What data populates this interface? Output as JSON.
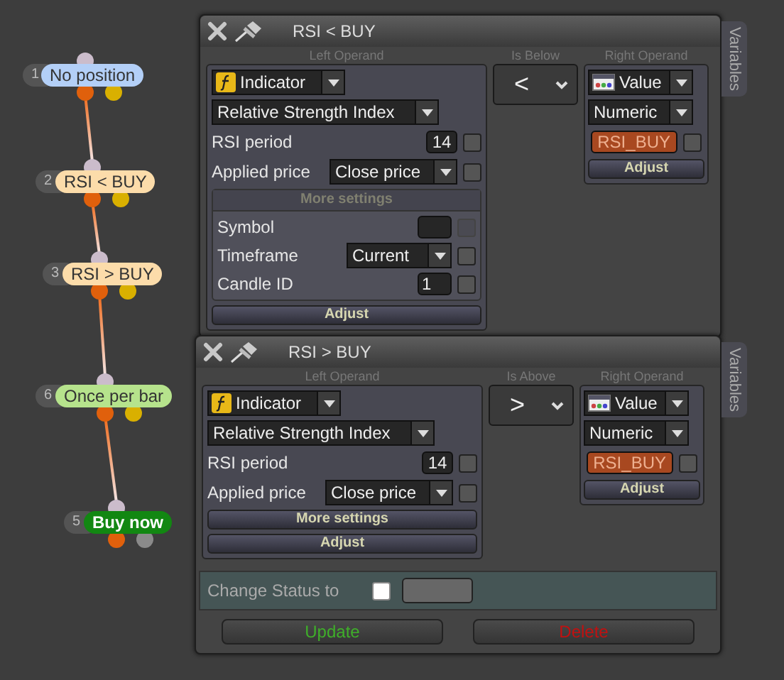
{
  "nodes": [
    {
      "number": "1",
      "label": "No position",
      "color": "#b3cff7",
      "kind": "condition"
    },
    {
      "number": "2",
      "label": "RSI < BUY",
      "color": "#fcdcaa",
      "kind": "condition"
    },
    {
      "number": "3",
      "label": "RSI > BUY",
      "color": "#fcdcaa",
      "kind": "condition"
    },
    {
      "number": "6",
      "label": "Once per bar",
      "color": "#b6e38c",
      "kind": "condition"
    },
    {
      "number": "5",
      "label": "Buy now",
      "color": "#128712",
      "kind": "action"
    }
  ],
  "panels": [
    {
      "title": "RSI < BUY",
      "left_operand_label": "Left Operand",
      "source": "Indicator",
      "indicator": "Relative Strength Index",
      "params": [
        {
          "kind": "number",
          "label": "RSI period",
          "value": "14",
          "checked": false
        },
        {
          "kind": "select",
          "label": "Applied price",
          "value": "Close price",
          "checked": false
        }
      ],
      "more_settings": {
        "label": "More settings",
        "expanded": true,
        "params": [
          {
            "kind": "number",
            "label": "Symbol",
            "checked": false,
            "disabled": true
          },
          {
            "kind": "select",
            "label": "Timeframe",
            "value": "Current",
            "checked": false
          },
          {
            "kind": "number",
            "label": "Candle ID",
            "value": "1",
            "checked": false
          }
        ]
      },
      "adjust": "Adjust",
      "operator_label": "Is Below",
      "operator": "<",
      "right_operand_label": "Right Operand",
      "right_type": "Value",
      "right_subtype": "Numeric",
      "variable": "RSI_BUY",
      "variable_checked": false,
      "right_adjust": "Adjust",
      "side_tab": "Variables"
    },
    {
      "title": "RSI > BUY",
      "left_operand_label": "Left Operand",
      "source": "Indicator",
      "indicator": "Relative Strength Index",
      "params": [
        {
          "kind": "number",
          "label": "RSI period",
          "value": "14",
          "checked": false
        },
        {
          "kind": "select",
          "label": "Applied price",
          "value": "Close price",
          "checked": false
        }
      ],
      "more_settings": {
        "label": "More settings",
        "expanded": false
      },
      "adjust": "Adjust",
      "operator_label": "Is Above",
      "operator": ">",
      "right_operand_label": "Right Operand",
      "right_type": "Value",
      "right_subtype": "Numeric",
      "variable": "RSI_BUY",
      "variable_checked": false,
      "right_adjust": "Adjust",
      "side_tab": "Variables",
      "status": {
        "label": "Change Status to",
        "checked": false
      },
      "buttons": [
        {
          "label": "Update",
          "kind": "update"
        },
        {
          "label": "Delete",
          "kind": "delete"
        }
      ]
    }
  ]
}
